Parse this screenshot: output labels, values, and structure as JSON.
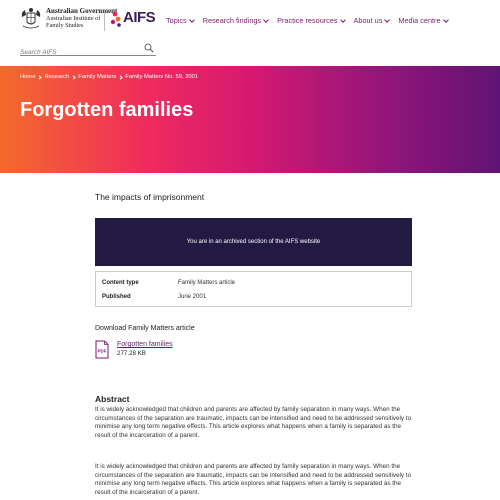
{
  "header": {
    "gov_line1": "Australian Government",
    "gov_line2": "Australian Institute of",
    "gov_line3": "Family Studies",
    "logo_text": "AIFS",
    "nav": [
      {
        "label": "Topics"
      },
      {
        "label": "Research findings"
      },
      {
        "label": "Practice resources"
      },
      {
        "label": "About us"
      },
      {
        "label": "Media centre"
      }
    ],
    "search_placeholder": "Search AIFS"
  },
  "banner": {
    "breadcrumbs": [
      "Home",
      "Research",
      "Family Matters",
      "Family Matters No. 59, 2001"
    ],
    "title": "Forgotten families"
  },
  "main": {
    "subtitle": "The impacts of imprisonment",
    "archive_notice": "You are in an archived section of the AIFS website",
    "meta": {
      "content_type_label": "Content type",
      "content_type_value": "Family Matters article",
      "published_label": "Published",
      "published_value": "June 2001"
    },
    "download": {
      "heading": "Download Family Matters article",
      "link": "Forgotten families",
      "size": "277.28 KB",
      "icon_text": "PDF"
    },
    "abstract": {
      "heading": "Abstract",
      "paragraph1": "It is widely acknowledged that children and parents are affected by family separation in many ways. When the circumstances of the separation are traumatic, impacts can be intensified and need to be addressed sensitively to minimise any long term negative effects. This article explores what happens when a family is separated as the result of the incarceration of a parent.",
      "paragraph2": "It is widely acknowledged that children and parents are affected by family separation in many ways. When the circumstances of the separation are traumatic, impacts can be intensified and need to be addressed sensitively to minimise any long term negative effects. This article explores what happens when a family is separated as the result of the incarceration of a parent."
    }
  },
  "colors": {
    "brand_purple": "#7a1b6e",
    "archive_bg": "#221a43",
    "gradient_start": "#f46a2a",
    "gradient_end": "#5f1475"
  }
}
